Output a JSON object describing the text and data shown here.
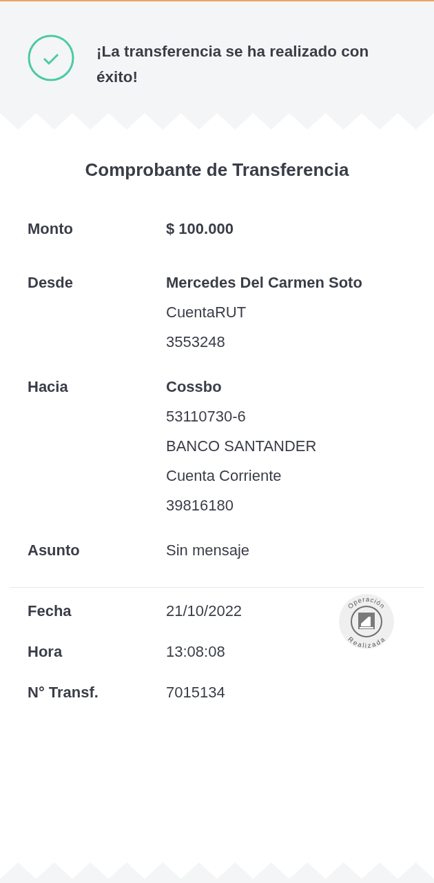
{
  "banner": {
    "message": "¡La transferencia se ha realizado con éxito!"
  },
  "receipt": {
    "title": "Comprobante de Transferencia",
    "details": [
      {
        "label": "Monto",
        "lines": [
          {
            "text": "$ 100.000",
            "strong": true
          }
        ]
      },
      {
        "label": "Desde",
        "lines": [
          {
            "text": "Mercedes Del Carmen Soto",
            "strong": true
          },
          {
            "text": "CuentaRUT",
            "strong": false
          },
          {
            "text": "3553248",
            "strong": false
          }
        ]
      },
      {
        "label": "Hacia",
        "lines": [
          {
            "text": "Cossbo",
            "strong": true
          },
          {
            "text": "53110730-6",
            "strong": false
          },
          {
            "text": "BANCO SANTANDER",
            "strong": false
          },
          {
            "text": "Cuenta Corriente",
            "strong": false
          },
          {
            "text": "39816180",
            "strong": false
          }
        ]
      },
      {
        "label": "Asunto",
        "lines": [
          {
            "text": "Sin mensaje",
            "strong": false
          }
        ]
      }
    ],
    "meta": [
      {
        "label": "Fecha",
        "lines": [
          {
            "text": "21/10/2022",
            "strong": false
          }
        ]
      },
      {
        "label": "Hora",
        "lines": [
          {
            "text": "13:08:08",
            "strong": false
          }
        ]
      },
      {
        "label": "N° Transf.",
        "lines": [
          {
            "text": "7015134",
            "strong": false
          }
        ]
      }
    ],
    "stamp": {
      "top_text": "Operación",
      "bottom_text": "Realizada"
    }
  }
}
